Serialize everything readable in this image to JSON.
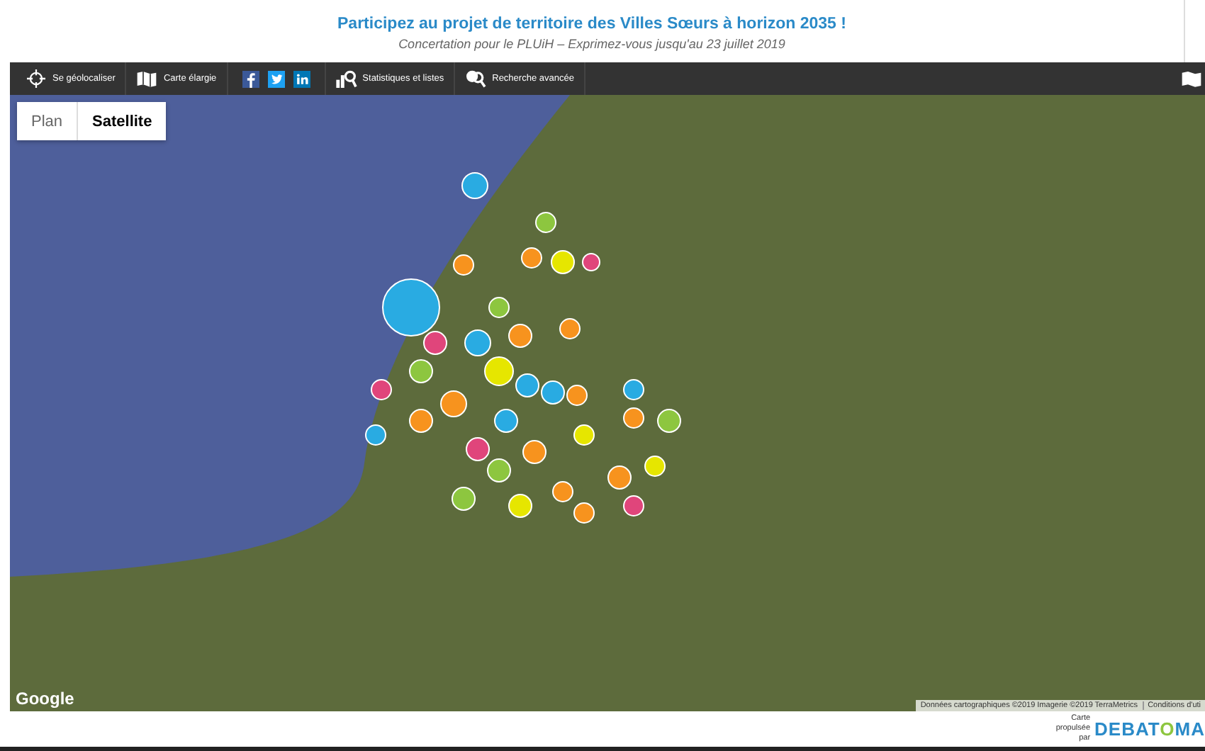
{
  "header": {
    "title": "Participez au projet de territoire des Villes Sœurs à horizon 2035 !",
    "subtitle": "Concertation pour le PLUiH – Exprimez-vous jusqu'au 23 juillet 2019"
  },
  "toolbar": [
    {
      "kind": "locate",
      "label": "Se géolocaliser"
    },
    {
      "kind": "map",
      "label": "Carte élargie"
    },
    {
      "kind": "social"
    },
    {
      "kind": "stats",
      "label": "Statistiques et listes"
    },
    {
      "kind": "search",
      "label": "Recherche avancée"
    }
  ],
  "map_types": [
    {
      "label": "Plan",
      "selected": false
    },
    {
      "label": "Satellite",
      "selected": true
    }
  ],
  "map": {
    "logo": "Google",
    "attribution": "Données cartographiques ©2019 Imagerie ©2019 TerraMetrics",
    "terms": "Conditions d'uti"
  },
  "footer": {
    "powered_by": "Carte propulsée par",
    "brand": "DEBATOMA"
  }
}
